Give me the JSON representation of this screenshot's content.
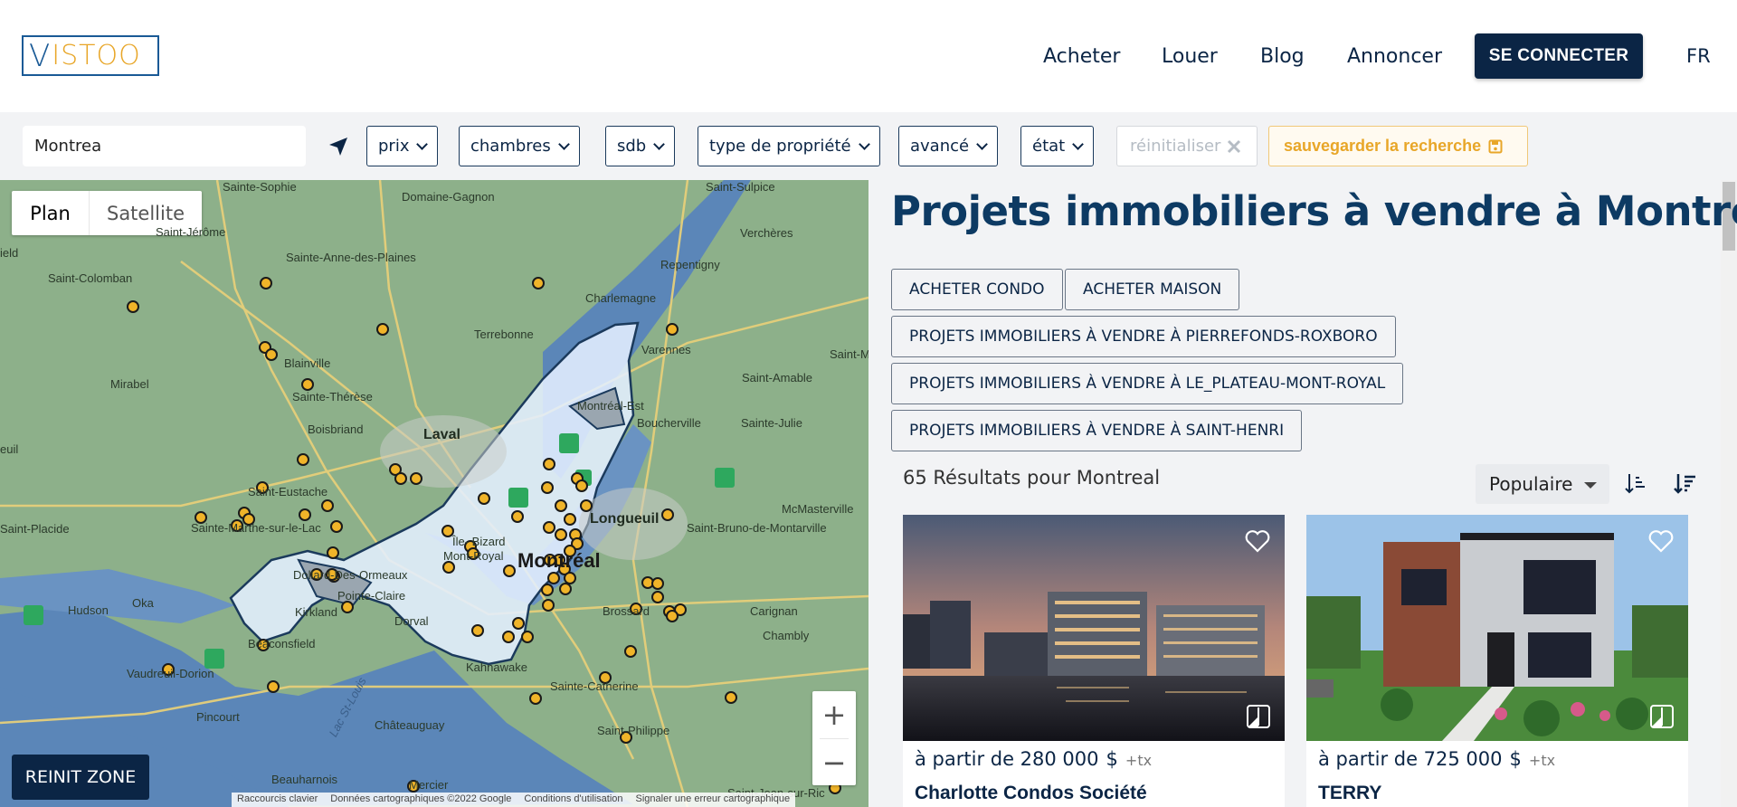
{
  "header": {
    "logo_v": "V",
    "logo_rest": "ISTOO",
    "nav": [
      "Acheter",
      "Louer",
      "Blog",
      "Annoncer"
    ],
    "login_label": "SE CONNECTER",
    "lang": "FR"
  },
  "filters": {
    "search_value": "Montrea",
    "prix": "prix",
    "chambres": "chambres",
    "sdb": "sdb",
    "type": "type de propriété",
    "avance": "avancé",
    "etat": "état",
    "reset": "réinitialiser",
    "save": "sauvegarder la recherche"
  },
  "map": {
    "tab_plan": "Plan",
    "tab_satellite": "Satellite",
    "reinit": "REINIT ZONE",
    "zoom_in": "+",
    "zoom_out": "−",
    "attribution": [
      "Raccourcis clavier",
      "Données cartographiques ©2022 Google",
      "Conditions d'utilisation",
      "Signaler une erreur cartographique"
    ],
    "labels": {
      "saint_sophie": "Sainte-Sophie",
      "domaine_gagnon": "Domaine-Gagnon",
      "saint_sulpice": "Saint-Sulpice",
      "saint_jerome": "Saint-Jérôme",
      "sainte_anne": "Sainte-Anne-des-Plaines",
      "vercheres": "Verchères",
      "saint_colomban": "Saint-Colomban",
      "repentigny": "Repentigny",
      "charlemagne": "Charlemagne",
      "terrebonne": "Terrebonne",
      "blainville": "Blainville",
      "varennes": "Varennes",
      "saint_marc": "Saint-Marc-s",
      "mirabel": "Mirabel",
      "sainte_therese": "Sainte-Thérèse",
      "saint_amable": "Saint-Amable",
      "montreal_est": "Montréal-Est",
      "boisbriand": "Boisbriand",
      "laval": "Laval",
      "boucherville": "Boucherville",
      "sainte_julie": "Sainte-Julie",
      "saint_eustache": "Saint-Eustache",
      "longueuil": "Longueuil",
      "mcmasterville": "McMasterville",
      "saint_placide": "Saint-Placide",
      "sainte_marthe": "Sainte-Marthe-sur-le-Lac",
      "saint_bruno": "Saint-Bruno-de-Montarville",
      "ile_bizard": "Île-\nBizard",
      "mont_royal": "Mont-Royal",
      "montreal": "Montréal",
      "dollard": "Dollard-Des-Ormeaux",
      "pointe_claire": "Pointe-Claire",
      "kirkland": "Kirkland",
      "hudson": "Hudson",
      "oka": "Oka",
      "dorval": "Dorval",
      "brossard": "Brossard",
      "carignan": "Carignan",
      "beaconsfield": "Beaconsfield",
      "chambly": "Chambly",
      "vaudreuil": "Vaudreuil-Dorion",
      "kahnawake": "Kahnawake",
      "lac_st_louis": "Lac St-Louis",
      "sainte_catherine": "Sainte-Catherine",
      "pincourt": "Pincourt",
      "chateauguay": "Châteauguay",
      "saint_philippe": "Saint-Philippe",
      "beauharnois": "Beauharnois",
      "mercier": "Mercier",
      "saint_jean": "Saint-Jean-sur-Ric",
      "ield": "ield",
      "euil": "euil"
    }
  },
  "listing": {
    "title": "Projets immobiliers à vendre à Montreal",
    "tags": [
      "ACHETER CONDO",
      "ACHETER MAISON",
      "PROJETS IMMOBILIERS À VENDRE À PIERREFONDS-ROXBORO",
      "PROJETS IMMOBILIERS À VENDRE À LE_PLATEAU-MONT-ROYAL",
      "PROJETS IMMOBILIERS À VENDRE À SAINT-HENRI"
    ],
    "results": "65 Résultats pour Montreal",
    "sort_selected": "Populaire",
    "cards": [
      {
        "price_prefix": "à partir de 280 000",
        "currency": "$",
        "tax": "+tx",
        "name": "Charlotte Condos Société"
      },
      {
        "price_prefix": "à partir de 725 000",
        "currency": "$",
        "tax": "+tx",
        "name": "TERRY"
      }
    ]
  },
  "colors": {
    "navy": "#0b2545",
    "title_blue": "#0d3a63",
    "accent_gold": "#e8a628",
    "map_green": "#8db08a",
    "map_water": "#5b86b8",
    "zone_fill": "#e4efff"
  }
}
